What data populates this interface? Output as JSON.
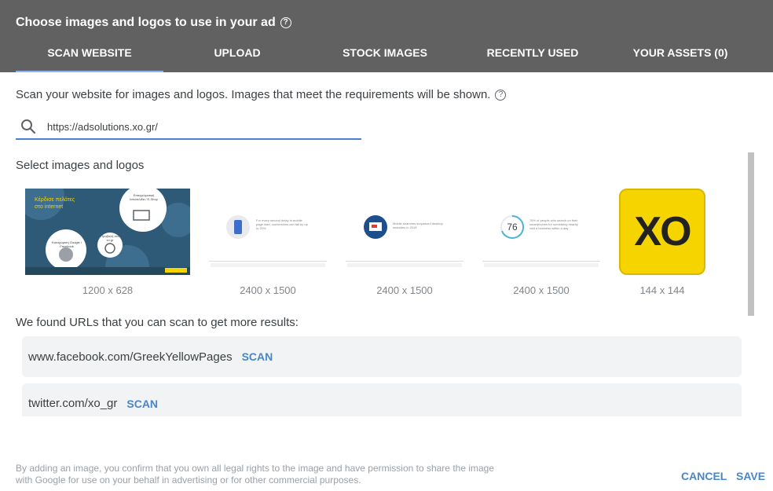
{
  "header": {
    "title": "Choose images and logos to use in your ad",
    "tabs": [
      {
        "label": "SCAN WEBSITE",
        "active": true
      },
      {
        "label": "UPLOAD",
        "active": false
      },
      {
        "label": "STOCK IMAGES",
        "active": false
      },
      {
        "label": "RECENTLY USED",
        "active": false
      },
      {
        "label": "YOUR ASSETS (0)",
        "active": false
      }
    ]
  },
  "scan": {
    "description": "Scan your website for images and logos. Images that meet the requirements will be shown.",
    "url_value": "https://adsolutions.xo.gr/"
  },
  "images": {
    "section_label": "Select images and logos",
    "items": [
      {
        "dimensions": "1200 x 628",
        "banner_title": "Κέρδισε πελάτες στο internet",
        "bubble_1": "Καταχώριση Google / Facebook",
        "bubble_2": "Επαγγελματική Ιστοσελίδα / E-Shop",
        "bubble_3": "Προβολή στο xo.gr"
      },
      {
        "dimensions": "2400 x 1500",
        "caption": "For every second delay in mobile page load, conversions can fall by up to 20%"
      },
      {
        "dimensions": "2400 x 1500",
        "caption": "Mobile searches surpassed desktop searches in 2015"
      },
      {
        "dimensions": "2400 x 1500",
        "badge": "76",
        "caption": "76% of people who search on their smartphones for something nearby visit a business within a day"
      },
      {
        "dimensions": "144 x 144",
        "logo_text": "XO"
      }
    ]
  },
  "found": {
    "label": "We found URLs that you can scan to get more results:",
    "urls": [
      {
        "url": "www.facebook.com/GreekYellowPages",
        "action": "SCAN"
      },
      {
        "url": "twitter.com/xo_gr",
        "action": "SCAN"
      }
    ]
  },
  "footer": {
    "disclaimer": "By adding an image, you confirm that you own all legal rights to the image and have permission to share the image with Google for use on your behalf in advertising or for other commercial purposes.",
    "cancel_label": "CANCEL",
    "save_label": "SAVE"
  },
  "colors": {
    "header_bg": "#616161",
    "accent_blue": "#4a86c7",
    "logo_yellow": "#f5d400",
    "banner_blue": "#2e5a78"
  }
}
